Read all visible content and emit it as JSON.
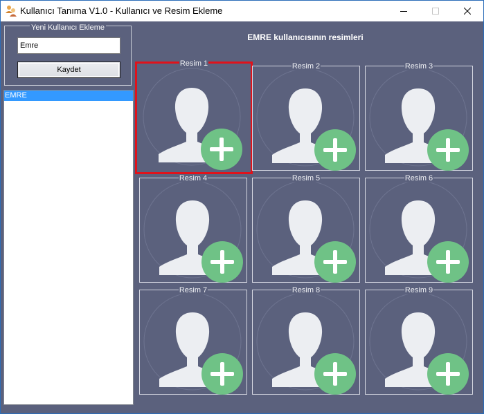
{
  "window": {
    "title": "Kullanıcı Tanıma V1.0 - Kullanıcı ve Resim Ekleme",
    "icon": "app-users-icon",
    "controls": [
      "minimize-icon",
      "maximize-icon",
      "close-icon"
    ]
  },
  "colors": {
    "background": "#5b617d",
    "avatar": "#eceef2",
    "add_badge": "#6fc286",
    "selection": "#e0121b",
    "list_selected": "#3399ff"
  },
  "new_user": {
    "legend": "Yeni Kullanıcı Ekleme",
    "name_value": "Emre",
    "save_label": "Kaydet"
  },
  "users": {
    "items": [
      {
        "label": "EMRE",
        "selected": true
      }
    ]
  },
  "images": {
    "heading": "EMRE kullanıcısının resimleri",
    "selected_index": 0,
    "slots": [
      {
        "label": "Resim 1",
        "icon": "add-image-icon"
      },
      {
        "label": "Resim 2",
        "icon": "add-image-icon"
      },
      {
        "label": "Resim 3",
        "icon": "add-image-icon"
      },
      {
        "label": "Resim 4",
        "icon": "add-image-icon"
      },
      {
        "label": "Resim 5",
        "icon": "add-image-icon"
      },
      {
        "label": "Resim 6",
        "icon": "add-image-icon"
      },
      {
        "label": "Resim 7",
        "icon": "add-image-icon"
      },
      {
        "label": "Resim 8",
        "icon": "add-image-icon"
      },
      {
        "label": "Resim 9",
        "icon": "add-image-icon"
      }
    ]
  }
}
